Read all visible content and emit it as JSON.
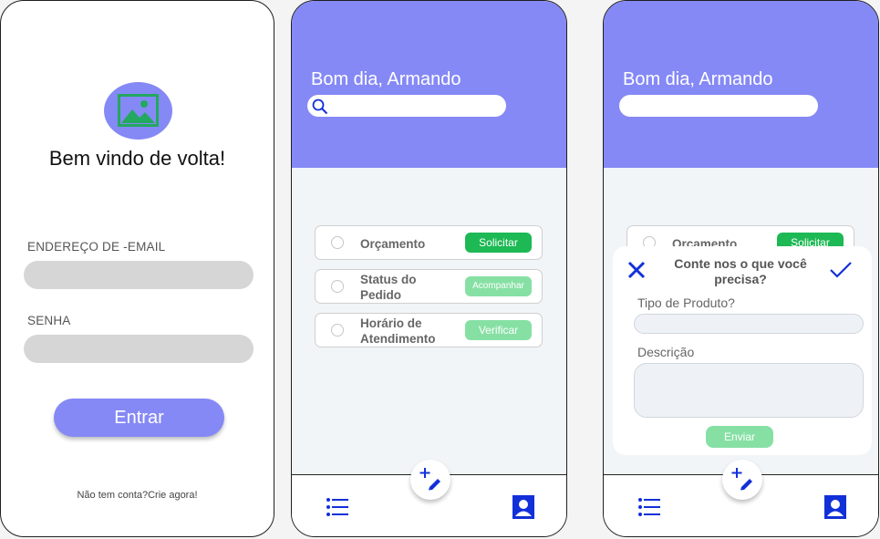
{
  "login": {
    "welcome_title": "Bem vindo de volta!",
    "email_label": "ENDEREÇO DE -EMAIL",
    "email_value": "",
    "password_label": "SENHA",
    "password_value": "",
    "login_button": "Entrar",
    "signup_text": "Não tem conta?Crie agora!"
  },
  "home": {
    "greeting": "Bom dia, Armando",
    "search_value": "",
    "cards": [
      {
        "label": "Orçamento",
        "action": "Solicitar",
        "style": "primary"
      },
      {
        "label": "Status do Pedido",
        "action": "Acompanhar",
        "style": "light"
      },
      {
        "label": "Horário de Atendimento",
        "action": "Verificar",
        "style": "light"
      }
    ],
    "nav": {
      "left_icon": "list-icon",
      "right_icon": "profile-icon",
      "fab_icon": "add-edit-icon"
    }
  },
  "request": {
    "greeting": "Bom dia, Armando",
    "background_card": {
      "label": "Orçamento",
      "action": "Solicitar"
    },
    "modal_title": "Conte nos o que você precisa?",
    "product_type_label": "Tipo de Produto?",
    "product_type_value": "",
    "description_label": "Descrição",
    "description_value": "",
    "send_button": "Enviar"
  },
  "colors": {
    "accent": "#8589f5",
    "primary_green": "#1db954",
    "light_green": "#86e0a4",
    "icon_blue": "#1230d8",
    "input_gray": "#d6d6d6",
    "content_bg": "#f1f5f8"
  }
}
